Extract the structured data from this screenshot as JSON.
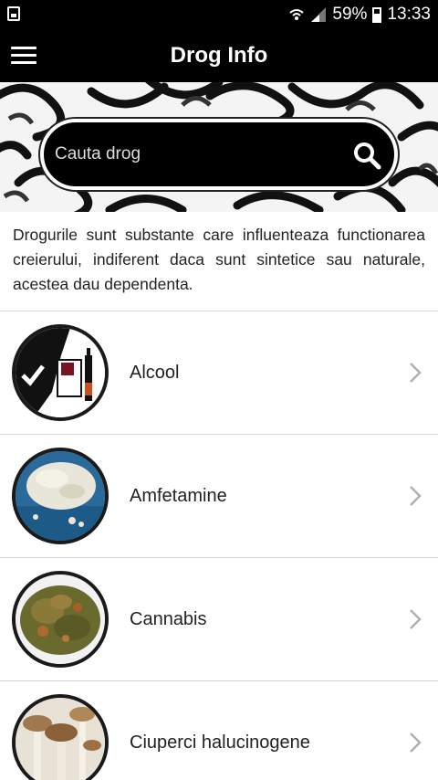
{
  "status_bar": {
    "battery": "59%",
    "time": "13:33"
  },
  "app_bar": {
    "title": "Drog Info"
  },
  "search": {
    "placeholder": "Cauta drog"
  },
  "description": "Drogurile sunt substante care influenteaza functionarea creierului, indiferent daca sunt sintetice sau naturale, acestea dau dependenta.",
  "drugs": [
    {
      "label": "Alcool",
      "icon": "alcohol-thumbnail"
    },
    {
      "label": "Amfetamine",
      "icon": "amphetamine-thumbnail"
    },
    {
      "label": "Cannabis",
      "icon": "cannabis-thumbnail"
    },
    {
      "label": "Ciuperci halucinogene",
      "icon": "mushrooms-thumbnail"
    }
  ],
  "colors": {
    "bar_background": "#000000",
    "text_primary": "#222222",
    "divider": "#d6d6d6",
    "chevron": "#b0b0b0"
  }
}
